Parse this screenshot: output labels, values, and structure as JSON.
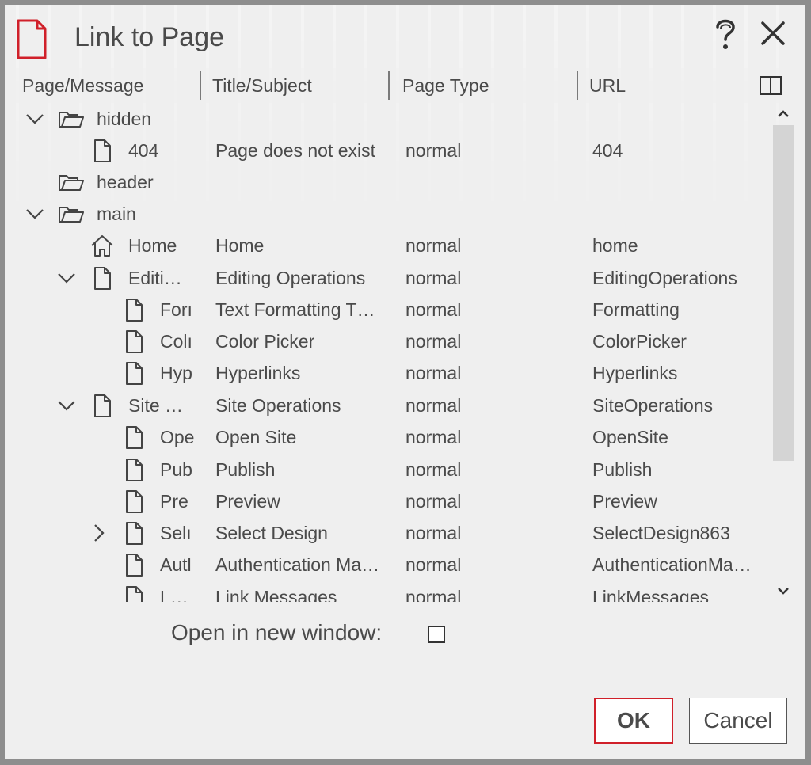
{
  "dialog": {
    "title": "Link to Page",
    "icons": {
      "title": "document-icon",
      "help": "help-icon",
      "close": "close-icon"
    }
  },
  "columns": {
    "page_message": "Page/Message",
    "title_subject": "Title/Subject",
    "page_type": "Page Type",
    "url": "URL",
    "toggle_icon": "columns-icon"
  },
  "rows": [
    {
      "level": 0,
      "chevron": "down",
      "icon": "folder",
      "name": "hidden",
      "title": "",
      "type": "",
      "url": ""
    },
    {
      "level": 1,
      "chevron": "",
      "icon": "page",
      "name": "404",
      "title": "Page does not exist",
      "type": "normal",
      "url": "404"
    },
    {
      "level": 0,
      "chevron": "",
      "icon": "folder",
      "name": "header",
      "title": "",
      "type": "",
      "url": ""
    },
    {
      "level": 0,
      "chevron": "down",
      "icon": "folder",
      "name": "main",
      "title": "",
      "type": "",
      "url": ""
    },
    {
      "level": 1,
      "chevron": "",
      "icon": "home",
      "name": "Home",
      "title": "Home",
      "type": "normal",
      "url": "home"
    },
    {
      "level": 1,
      "chevron": "down",
      "icon": "page",
      "name": "Editi…",
      "title": "Editing Operations",
      "type": "normal",
      "url": "EditingOperations"
    },
    {
      "level": 2,
      "chevron": "",
      "icon": "page",
      "name": "Forı",
      "title": "Text Formatting T…",
      "type": "normal",
      "url": "Formatting"
    },
    {
      "level": 2,
      "chevron": "",
      "icon": "page",
      "name": "Colı",
      "title": "Color Picker",
      "type": "normal",
      "url": "ColorPicker"
    },
    {
      "level": 2,
      "chevron": "",
      "icon": "page",
      "name": "Hyp",
      "title": "Hyperlinks",
      "type": "normal",
      "url": "Hyperlinks"
    },
    {
      "level": 1,
      "chevron": "down",
      "icon": "page",
      "name": "Site …",
      "title": "Site Operations",
      "type": "normal",
      "url": "SiteOperations"
    },
    {
      "level": 2,
      "chevron": "",
      "icon": "page",
      "name": "Ope",
      "title": "Open Site",
      "type": "normal",
      "url": "OpenSite"
    },
    {
      "level": 2,
      "chevron": "",
      "icon": "page",
      "name": "Pub",
      "title": "Publish",
      "type": "normal",
      "url": "Publish"
    },
    {
      "level": 2,
      "chevron": "",
      "icon": "page",
      "name": "Pre",
      "title": "Preview",
      "type": "normal",
      "url": "Preview"
    },
    {
      "level": 2,
      "chevron": "right",
      "icon": "page",
      "name": "Selı",
      "title": "Select Design",
      "type": "normal",
      "url": "SelectDesign863"
    },
    {
      "level": 2,
      "chevron": "",
      "icon": "page",
      "name": "Autl",
      "title": "Authentication Ma…",
      "type": "normal",
      "url": "AuthenticationMa…"
    },
    {
      "level": 2,
      "chevron": "",
      "icon": "page",
      "name": "L…",
      "title": "Link Messages",
      "type": "normal",
      "url": "LinkMessages"
    }
  ],
  "options": {
    "open_new_window_label": "Open in new window:",
    "open_new_window_checked": false
  },
  "buttons": {
    "ok": "OK",
    "cancel": "Cancel"
  },
  "colors": {
    "accent": "#d0202a",
    "text": "#4a4a4a",
    "background": "#efefef"
  }
}
